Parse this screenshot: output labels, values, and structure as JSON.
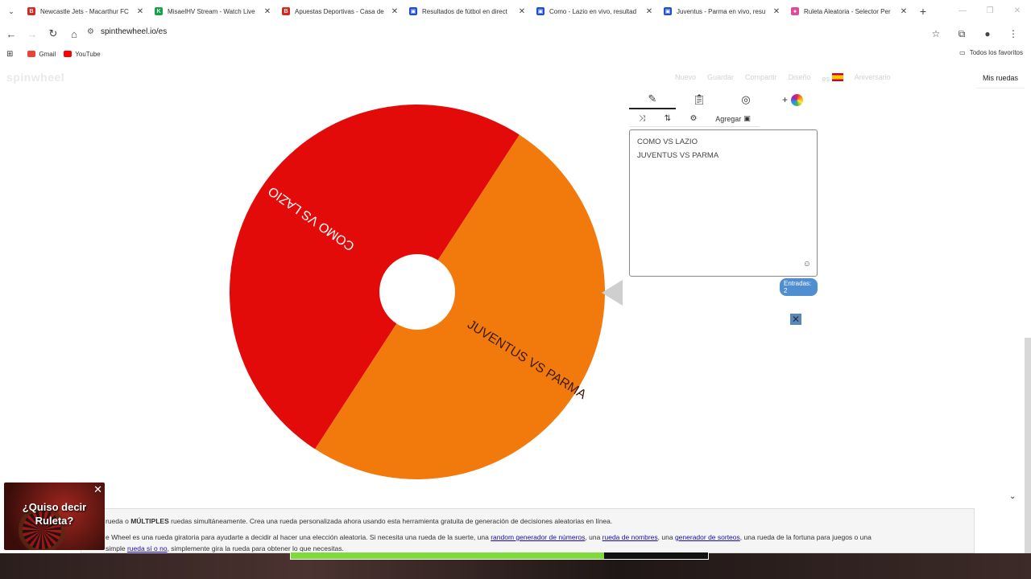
{
  "browser": {
    "tabs": [
      {
        "title": "Newcastle Jets - Macarthur FC",
        "favicon_color": "#d9261c",
        "favicon_glyph": "B",
        "active": false
      },
      {
        "title": "MisaelHV Stream - Watch Live",
        "favicon_color": "#15a34a",
        "favicon_glyph": "K",
        "active": false
      },
      {
        "title": "Apuestas Deportivas - Casa de",
        "favicon_color": "#d9261c",
        "favicon_glyph": "B",
        "active": false
      },
      {
        "title": "Resultados de fútbol en direct",
        "favicon_color": "#1d4ed8",
        "favicon_glyph": "▣",
        "active": false
      },
      {
        "title": "Como - Lazio en vivo, resultad",
        "favicon_color": "#1d4ed8",
        "favicon_glyph": "▣",
        "active": false
      },
      {
        "title": "Juventus - Parma en vivo, resu",
        "favicon_color": "#1d4ed8",
        "favicon_glyph": "▣",
        "active": false
      },
      {
        "title": "Ruleta Aleatoria - Selector Per",
        "favicon_color": "#e04a9a",
        "favicon_glyph": "●",
        "active": true
      }
    ],
    "new_tab_label": "+",
    "url": "spinthewheel.io/es",
    "bookmarks": [
      {
        "label": "Gmail",
        "color": "#ea4335"
      },
      {
        "label": "YouTube",
        "color": "#ff0000"
      }
    ],
    "all_bookmarks_label": "Todos los favoritos"
  },
  "site": {
    "logo": "spinwheel",
    "nav": [
      "Nuevo",
      "Guardar",
      "Compartir",
      "Diseño",
      "es",
      "Aniversario"
    ],
    "my_wheels": "Mis ruedas"
  },
  "wheel": {
    "segments": [
      {
        "label": "COMO VS LAZIO",
        "color": "#e30a0a",
        "text_color": "#ffffff"
      },
      {
        "label": "JUVENTUS VS PARMA",
        "color": "#f27a0c",
        "text_color": "#3a1a08"
      }
    ]
  },
  "editor": {
    "tab_icons": [
      "pencil-icon",
      "clipboard-icon",
      "eye-off-icon",
      "color-wheel-icon"
    ],
    "add_label": "Agregar",
    "entries": [
      "COMO VS LAZIO",
      "JUVENTUS VS PARMA"
    ],
    "count_label": "Entradas: 2"
  },
  "info": {
    "line1_prefix": "rueda o ",
    "line1_bold": "MÚLTIPLES",
    "line1_rest": " ruedas simultáneamente. Crea una rueda personalizada ahora usando esta herramienta gratuita de generación de decisiones aleatorias en línea.",
    "line2_a": "e Wheel es una rueda giratoria para ayudarte a decidir al hacer una elección aleatoria. Si necesita una rueda de la suerte, una ",
    "link1": "random generador de números",
    "line2_b": ", una ",
    "link2": "rueda de nombres",
    "line2_c": ", una ",
    "link3": "generador de sorteos",
    "line2_d": ", una rueda de la fortuna para juegos o una",
    "line3_a": "simple ",
    "link4": "rueda sí o no",
    "line3_b": ", simplemente gira la rueda para obtener lo que necesitas."
  },
  "ad": {
    "text": "¿Quiso decir Ruleta?",
    "close": "✕"
  },
  "progress": {
    "value_fraction": 0.75
  }
}
